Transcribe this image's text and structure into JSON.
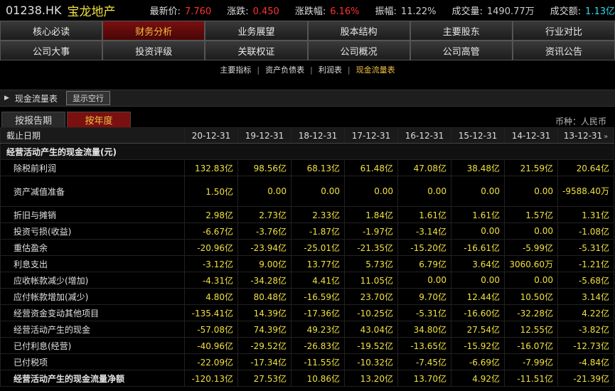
{
  "header": {
    "code": "01238.HK",
    "name": "宝龙地产",
    "quotes": [
      {
        "label": "最新价:",
        "value": "7.760",
        "color": "red"
      },
      {
        "label": "涨跌:",
        "value": "0.450",
        "color": "red"
      },
      {
        "label": "涨跌幅:",
        "value": "6.16%",
        "color": "red"
      },
      {
        "label": "振幅:",
        "value": "11.22%",
        "color": "grey"
      },
      {
        "label": "成交量:",
        "value": "1490.77万",
        "color": "grey"
      },
      {
        "label": "成交额:",
        "value": "1.13亿",
        "color": "cyan"
      }
    ]
  },
  "nav_row1": [
    "核心必读",
    "财务分析",
    "业务展望",
    "股本结构",
    "主要股东",
    "行业对比"
  ],
  "nav_row2": [
    "公司大事",
    "投资评级",
    "关联权证",
    "公司概况",
    "公司高管",
    "资讯公告"
  ],
  "nav_active": "财务分析",
  "subnav": [
    "主要指标",
    "资产负债表",
    "利润表",
    "现金流量表"
  ],
  "subnav_active": "现金流量表",
  "section_bar": {
    "title": "现金流量表",
    "button": "显示空行"
  },
  "tabs": [
    "按报告期",
    "按年度"
  ],
  "tab_active": "按年度",
  "currency": "币种：人民币",
  "table": {
    "head_label": "截止日期",
    "columns": [
      "20-12-31",
      "19-12-31",
      "18-12-31",
      "17-12-31",
      "16-12-31",
      "15-12-31",
      "14-12-31",
      "13-12-31"
    ],
    "scroll_icon": "»",
    "section_title": "经营活动产生的现金流量(元)",
    "rows": [
      {
        "label": "除税前利润",
        "values": [
          "132.83亿",
          "98.56亿",
          "68.13亿",
          "61.48亿",
          "47.08亿",
          "38.48亿",
          "21.59亿",
          "20.64亿"
        ]
      },
      {
        "label": "资产减值准备",
        "values": [
          "1.50亿",
          "0.00",
          "0.00",
          "0.00",
          "0.00",
          "0.00",
          "0.00",
          "-9588.40万"
        ],
        "tall": true
      },
      {
        "label": "折旧与摊销",
        "values": [
          "2.98亿",
          "2.73亿",
          "2.33亿",
          "1.84亿",
          "1.61亿",
          "1.61亿",
          "1.57亿",
          "1.31亿"
        ]
      },
      {
        "label": "投资亏损(收益)",
        "values": [
          "-6.67亿",
          "-3.76亿",
          "-1.87亿",
          "-1.97亿",
          "-3.14亿",
          "0.00",
          "0.00",
          "-1.08亿"
        ]
      },
      {
        "label": "重估盈余",
        "values": [
          "-20.96亿",
          "-23.94亿",
          "-25.01亿",
          "-21.35亿",
          "-15.20亿",
          "-16.61亿",
          "-5.99亿",
          "-5.31亿"
        ]
      },
      {
        "label": "利息支出",
        "values": [
          "-3.12亿",
          "9.00亿",
          "13.77亿",
          "5.73亿",
          "6.79亿",
          "3.64亿",
          "3060.60万",
          "-1.21亿"
        ]
      },
      {
        "label": "应收帐款减少(增加)",
        "values": [
          "-4.31亿",
          "-34.28亿",
          "4.41亿",
          "11.05亿",
          "0.00",
          "0.00",
          "0.00",
          "-5.68亿"
        ]
      },
      {
        "label": "应付帐款增加(减少)",
        "values": [
          "4.80亿",
          "80.48亿",
          "-16.59亿",
          "23.70亿",
          "9.70亿",
          "12.44亿",
          "10.50亿",
          "3.14亿"
        ]
      },
      {
        "label": "经营资金变动其他项目",
        "values": [
          "-135.41亿",
          "14.39亿",
          "-17.36亿",
          "-10.25亿",
          "-5.31亿",
          "-16.60亿",
          "-32.28亿",
          "4.22亿"
        ]
      },
      {
        "label": "经营活动产生的现金",
        "values": [
          "-57.08亿",
          "74.39亿",
          "49.23亿",
          "43.04亿",
          "34.80亿",
          "27.54亿",
          "12.55亿",
          "-3.82亿"
        ]
      },
      {
        "label": "已付利息(经营)",
        "values": [
          "-40.96亿",
          "-29.52亿",
          "-26.83亿",
          "-19.52亿",
          "-13.65亿",
          "-15.92亿",
          "-16.07亿",
          "-12.73亿"
        ]
      },
      {
        "label": "已付税项",
        "values": [
          "-22.09亿",
          "-17.34亿",
          "-11.55亿",
          "-10.32亿",
          "-7.45亿",
          "-6.69亿",
          "-7.99亿",
          "-4.84亿"
        ]
      },
      {
        "label": "经营活动产生的现金流量净额",
        "values": [
          "-120.13亿",
          "27.53亿",
          "10.86亿",
          "13.20亿",
          "13.70亿",
          "4.92亿",
          "-11.51亿",
          "-21.39亿"
        ],
        "bold": true
      }
    ]
  }
}
